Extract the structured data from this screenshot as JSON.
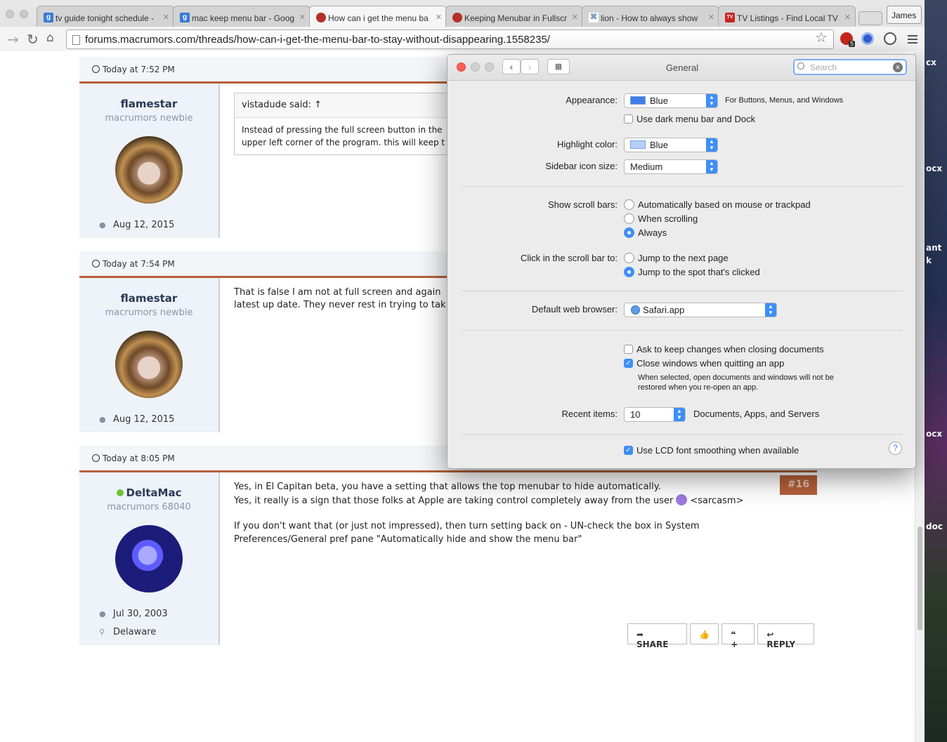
{
  "browser": {
    "tabs": [
      {
        "title": "tv guide tonight schedule -",
        "icon": "google-icon",
        "color": "#3a7bd5",
        "glyph": "g"
      },
      {
        "title": "mac keep menu bar - Goog",
        "icon": "google-icon",
        "color": "#3a7bd5",
        "glyph": "g"
      },
      {
        "title": "How can i get the menu ba",
        "icon": "macrumors-icon",
        "color": "#b5302a",
        "glyph": ""
      },
      {
        "title": "Keeping Menubar in Fullscr",
        "icon": "macrumors-icon",
        "color": "#b5302a",
        "glyph": ""
      },
      {
        "title": "lion - How to always show",
        "icon": "command-key-icon",
        "color": "#5a7bb5",
        "glyph": "⌘"
      },
      {
        "title": "TV Listings - Find Local TV",
        "icon": "tv-listings-icon",
        "color": "#c8261e",
        "glyph": "TV"
      }
    ],
    "profile_name": "James",
    "url": "forums.macrumors.com/threads/how-can-i-get-the-menu-bar-to-stay-without-disappearing.1558235/",
    "extension_badge": "5"
  },
  "desktop_labels": [
    "cx",
    "ocx",
    "ant",
    "k",
    "ocx",
    "doc"
  ],
  "posts": [
    {
      "time": "Today at 7:52 PM",
      "username": "flamestar",
      "user_title": "macrumors newbie",
      "joined": "Aug 12, 2015",
      "quote_author": "vistadude said: ↑",
      "quote_line1": "Instead of pressing the full screen button in the",
      "quote_line2": "upper left corner of the program. this will keep t"
    },
    {
      "time": "Today at 7:54 PM",
      "username": "flamestar",
      "user_title": "macrumors newbie",
      "joined": "Aug 12, 2015",
      "line1": "That is false I am not at full screen and again",
      "line2": "latest up date. They never rest in trying to tak"
    },
    {
      "time": "Today at 8:05 PM",
      "username": "DeltaMac",
      "user_title": "macrumors 68040",
      "joined": "Jul 30, 2003",
      "location": "Delaware",
      "post_number": "#16",
      "line1": "Yes, in El Capitan beta, you have a setting that allows the top menubar to hide automatically.",
      "line2a": "Yes, it really is a sign that those folks at Apple are taking control completely away from the user",
      "line2b": "<sarcasm>",
      "line3": "If you don't want that (or just not impressed), then turn setting back on - UN-check the box in System",
      "line4": "Preferences/General pref pane \"Automatically hide and show the menu bar\"",
      "buttons": {
        "share": "SHARE",
        "like": "",
        "quote": "+",
        "reply": "REPLY"
      }
    }
  ],
  "prefs": {
    "title": "General",
    "search_placeholder": "Search",
    "appearance_label": "Appearance:",
    "appearance_value": "Blue",
    "appearance_note": "For Buttons, Menus, and Windows",
    "dark_menu_label": "Use dark menu bar and Dock",
    "dark_menu_checked": false,
    "highlight_label": "Highlight color:",
    "highlight_value": "Blue",
    "sidebar_label": "Sidebar icon size:",
    "sidebar_value": "Medium",
    "scroll_label": "Show scroll bars:",
    "scroll_options": [
      "Automatically based on mouse or trackpad",
      "When scrolling",
      "Always"
    ],
    "scroll_selected": "Always",
    "click_label": "Click in the scroll bar to:",
    "click_options": [
      "Jump to the next page",
      "Jump to the spot that's clicked"
    ],
    "click_selected": "Jump to the spot that's clicked",
    "browser_label": "Default web browser:",
    "browser_value": "Safari.app",
    "ask_keep_label": "Ask to keep changes when closing documents",
    "ask_keep_checked": false,
    "close_windows_label": "Close windows when quitting an app",
    "close_windows_checked": true,
    "close_windows_note1": "When selected, open documents and windows will not be",
    "close_windows_note2": "restored when you re-open an app.",
    "recent_label": "Recent items:",
    "recent_value": "10",
    "recent_note": "Documents, Apps, and Servers",
    "lcd_label": "Use LCD font smoothing when available",
    "lcd_checked": true,
    "help": "?"
  }
}
